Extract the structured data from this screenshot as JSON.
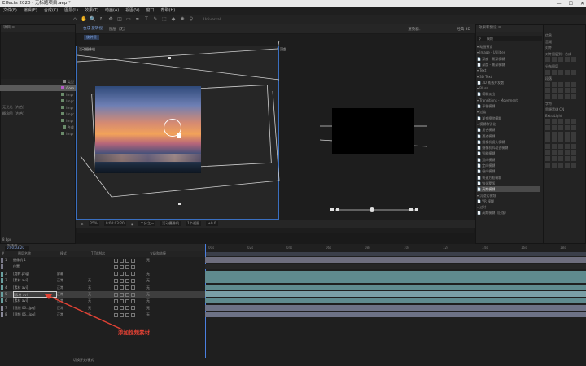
{
  "window": {
    "title": "Effects 2020 - 无标题项目.aep *",
    "controls": [
      "—",
      "☐",
      "✕"
    ]
  },
  "menu": [
    "文件(F)",
    "编辑(E)",
    "合成(C)",
    "图层(L)",
    "效果(T)",
    "动画(A)",
    "视图(V)",
    "窗口",
    "帮助(H)"
  ],
  "toolbar": {
    "tools": [
      "⌂",
      "✋",
      "🔍",
      "↻",
      "✥",
      "◫",
      "▭",
      "✒",
      "T",
      "✎",
      "⬚",
      "◆",
      "✺",
      "⚲"
    ],
    "workspace": "Universal"
  },
  "project": {
    "tab": "项目 ≡",
    "rows": [
      {
        "name": "",
        "type": "类型",
        "color": "#888888"
      },
      {
        "name": "",
        "type": "Com",
        "color": "#b65ac8"
      },
      {
        "name": "",
        "type": "Impr",
        "color": "#6a8a6a"
      },
      {
        "name": "",
        "type": "Impr",
        "color": "#6a8a6a"
      },
      {
        "name": "无光光（内合）",
        "type": "Impr",
        "color": "#6a8a6a"
      },
      {
        "name": "概念图（内合）",
        "type": "Impr",
        "color": "#6a8a6a"
      },
      {
        "name": "",
        "type": "Impr",
        "color": "#6a8a6a"
      },
      {
        "name": "",
        "type": "合成",
        "color": "#6a8a6a"
      },
      {
        "name": "",
        "type": "Impr",
        "color": "#6a8a6a"
      }
    ],
    "bpc": "8 bpc"
  },
  "comp": {
    "tab_label": "合成 旋转视",
    "tab_secondary": "图层（无）",
    "breadcrumb": "旋转视",
    "renderer_label": "渲染器：",
    "renderer": "经典 3D",
    "top_label": "活动摄像机",
    "side_label": "顶部"
  },
  "viewer_bar": {
    "zoom": "25%",
    "timecode": "0:00:03:20",
    "quality": "二分之一",
    "camera": "活动摄像机",
    "views": "1个视图",
    "offset": "+0.0"
  },
  "effects": {
    "tab": "效果和预设 ≡",
    "search": "模糊",
    "rows": [
      {
        "text": "▾ 动画预设",
        "sel": false
      },
      {
        "text": "  ▾ Image - Utilities",
        "sel": false
      },
      {
        "text": "     📄 深度 - 景深模糊",
        "sel": false
      },
      {
        "text": "     📄 深度 - 景深模糊",
        "sel": false
      },
      {
        "text": "  ▾ Text",
        "sel": false
      },
      {
        "text": "    ▾ 3D Text",
        "sel": false
      },
      {
        "text": "       📄 3D 跌落并发散",
        "sel": false
      },
      {
        "text": "    ▾ Blurs",
        "sel": false
      },
      {
        "text": "       📄 模糊淡出",
        "sel": false
      },
      {
        "text": "  ▾ Transitions - Movement",
        "sel": false
      },
      {
        "text": "     📄 平移模糊",
        "sel": false
      },
      {
        "text": "▾ 过渡",
        "sel": false
      },
      {
        "text": "   📄 渐变擦除模糊",
        "sel": false
      },
      {
        "text": "▾ 模糊和锐化",
        "sel": false
      },
      {
        "text": "   📄 复合模糊",
        "sel": false
      },
      {
        "text": "   📄 通道模糊",
        "sel": false
      },
      {
        "text": "   📄 摄像机镜头模糊",
        "sel": false
      },
      {
        "text": "   📄 摄像机抖动去模糊",
        "sel": false
      },
      {
        "text": "   📄 智能模糊",
        "sel": false
      },
      {
        "text": "   📄 双向模糊",
        "sel": false
      },
      {
        "text": "   📄 定向模糊",
        "sel": false
      },
      {
        "text": "   📄 径向模糊",
        "sel": false
      },
      {
        "text": "   📄 快速方框模糊",
        "sel": false
      },
      {
        "text": "   📄 钝化蒙版",
        "sel": false
      },
      {
        "text": "   📄 高斯模糊",
        "sel": true
      },
      {
        "text": "▾ 沉浸式视频",
        "sel": false
      },
      {
        "text": "   📄 VR 模糊",
        "sel": false
      },
      {
        "text": "▾ 过时",
        "sel": false
      },
      {
        "text": "   📄 高斯模糊（旧版）",
        "sel": false
      }
    ]
  },
  "right": {
    "rows": [
      "信息",
      "音频",
      "对齐",
      "对齐图层到：合成",
      "",
      "分布图层",
      "",
      "段落",
      "",
      "",
      "",
      "字符",
      "思源黑体 CN",
      "ExtraLight",
      "",
      "",
      "",
      "",
      "",
      "",
      "",
      ""
    ]
  },
  "timeline": {
    "tab": "旋转视 ≡",
    "timecode": "0:00:03:20",
    "columns": [
      "#",
      "图层名称",
      "模式",
      "T TrkMat",
      "父级和链接"
    ],
    "ruler": [
      "00s",
      "02s",
      "04s",
      "06s",
      "08s",
      "10s",
      "12s",
      "14s",
      "16s",
      "18s"
    ],
    "layers": [
      {
        "num": "1",
        "name": "摄像机 1",
        "mode": "",
        "trk": "",
        "parent": "无",
        "sel": false,
        "color": "#7a7a8a"
      },
      {
        "num": "",
        "name": "位置",
        "mode": "",
        "trk": "",
        "parent": "",
        "sel": false,
        "color": "#7a7a8a"
      },
      {
        "num": "2",
        "name": "[旋转.png]",
        "mode": "屏幕",
        "trk": "",
        "parent": "无",
        "sel": false,
        "color": "#6aa0a0"
      },
      {
        "num": "3",
        "name": "[素材 avi]",
        "mode": "正常",
        "trk": "无",
        "parent": "无",
        "sel": false,
        "color": "#6aa0a0"
      },
      {
        "num": "4",
        "name": "[素材 avi]",
        "mode": "正常",
        "trk": "无",
        "parent": "无",
        "sel": false,
        "color": "#6aa0a0"
      },
      {
        "num": "5",
        "name": "[素材 avi]",
        "mode": "正常",
        "trk": "无",
        "parent": "无",
        "sel": true,
        "color": "#6aa0a0"
      },
      {
        "num": "6",
        "name": "[素材 avi]",
        "mode": "正常",
        "trk": "无",
        "parent": "无",
        "sel": false,
        "color": "#6aa0a0"
      },
      {
        "num": "7",
        "name": "[视频 06...jpg]",
        "mode": "正常",
        "trk": "无",
        "parent": "无",
        "sel": false,
        "color": "#8a8a9a"
      },
      {
        "num": "8",
        "name": "[视频 06...jpg]",
        "mode": "正常",
        "trk": "无",
        "parent": "无",
        "sel": false,
        "color": "#8a8a9a"
      }
    ],
    "footer": "切换开关/模式"
  },
  "annotation": "添加视频素材",
  "colors": {
    "accent": "#4a7fe0",
    "annotation": "#e34234",
    "selection": "#4a4a4a"
  }
}
